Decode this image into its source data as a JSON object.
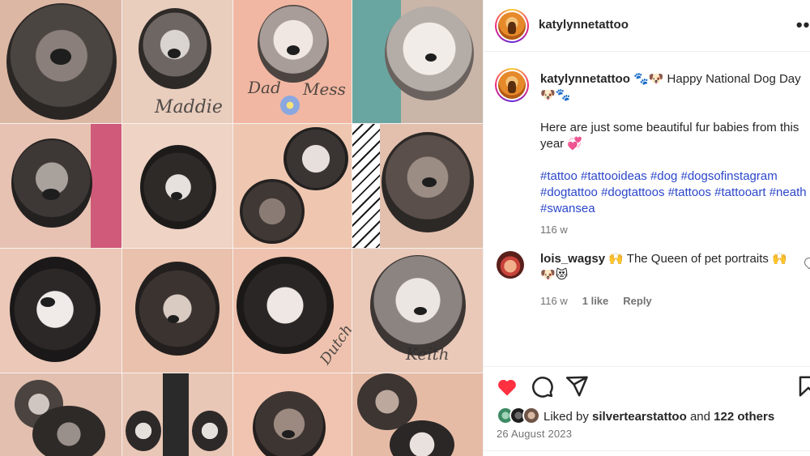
{
  "post": {
    "username": "katylynnetattoo",
    "more_label": "•••",
    "caption": {
      "author": "katylynnetattoo",
      "line1": "🐾🐶 Happy National Dog Day 🐶🐾",
      "line2": "Here are just some beautiful fur babies from this year 💞",
      "hashtags": "#tattoo #tattooideas #dog #dogsofinstagram #dogtattoo #dogtattoos #tattoos #tattooart #neath #swansea",
      "time": "116 w"
    },
    "comment": {
      "author": "lois_wagsy",
      "text": "🙌 The Queen of pet portraits 🙌 🐶😻",
      "time": "116 w",
      "likes": "1 like",
      "reply": "Reply"
    },
    "liked_by": {
      "prefix": "Liked by",
      "user": "silvertearstattoo",
      "conj": "and",
      "others": "122 others"
    },
    "date": "26 August 2023"
  },
  "collage": {
    "tattoo_names": [
      "Dad",
      "Mess",
      "Maddie",
      "Dutch",
      "Keith"
    ]
  },
  "colors": {
    "like_red": "#ff3040",
    "hashtag_blue": "#00376b",
    "muted": "#737373",
    "text": "#262626"
  },
  "icons": [
    "heart-icon",
    "comment-icon",
    "share-icon",
    "bookmark-icon",
    "more-icon"
  ]
}
